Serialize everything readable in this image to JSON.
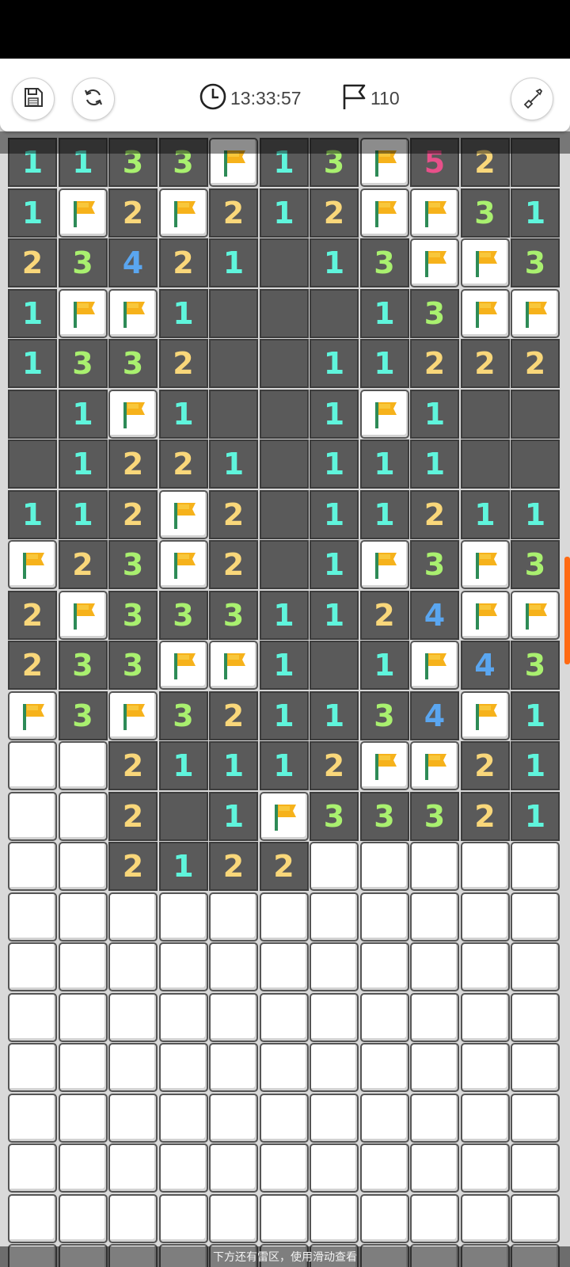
{
  "toolbar": {
    "timer": "13:33:57",
    "flags_remaining": "110",
    "buttons": [
      {
        "name": "save-button",
        "icon": "floppy-disk-icon"
      },
      {
        "name": "restart-button",
        "icon": "refresh-icon"
      },
      {
        "name": "tool-button",
        "icon": "shovel-icon"
      }
    ]
  },
  "board": {
    "columns": 11,
    "number_colors": {
      "1": "#5ff5dc",
      "2": "#f9d77a",
      "3": "#a9f06f",
      "4": "#5aa6f0",
      "5": "#e8508a"
    },
    "rows": [
      [
        "1",
        "1",
        "3",
        "3",
        "F",
        "1",
        "3",
        "F",
        "5",
        "2",
        "."
      ],
      [
        "1",
        "F",
        "2",
        "F",
        "2",
        "1",
        "2",
        "F",
        "F",
        "3",
        "1"
      ],
      [
        "2",
        "3",
        "4",
        "2",
        "1",
        ".",
        "1",
        "3",
        "F",
        "F",
        "3"
      ],
      [
        "1",
        "F",
        "F",
        "1",
        ".",
        ".",
        ".",
        "1",
        "3",
        "F",
        "F"
      ],
      [
        "1",
        "3",
        "3",
        "2",
        ".",
        ".",
        "1",
        "1",
        "2",
        "2",
        "2"
      ],
      [
        ".",
        "1",
        "F",
        "1",
        ".",
        ".",
        "1",
        "F",
        "1",
        ".",
        "."
      ],
      [
        ".",
        "1",
        "2",
        "2",
        "1",
        ".",
        "1",
        "1",
        "1",
        ".",
        "."
      ],
      [
        "1",
        "1",
        "2",
        "F",
        "2",
        ".",
        "1",
        "1",
        "2",
        "1",
        "1"
      ],
      [
        "F",
        "2",
        "3",
        "F",
        "2",
        ".",
        "1",
        "F",
        "3",
        "F",
        "3"
      ],
      [
        "2",
        "F",
        "3",
        "3",
        "3",
        "1",
        "1",
        "2",
        "4",
        "F",
        "F"
      ],
      [
        "2",
        "3",
        "3",
        "F",
        "F",
        "1",
        ".",
        "1",
        "F",
        "4",
        "3"
      ],
      [
        "F",
        "3",
        "F",
        "3",
        "2",
        "1",
        "1",
        "3",
        "4",
        "F",
        "1"
      ],
      [
        "#",
        "#",
        "2",
        "1",
        "1",
        "1",
        "2",
        "F",
        "F",
        "2",
        "1"
      ],
      [
        "#",
        "#",
        "2",
        ".",
        "1",
        "F",
        "3",
        "3",
        "3",
        "2",
        "1"
      ],
      [
        "#",
        "#",
        "2",
        "1",
        "2",
        "2",
        "#",
        "#",
        "#",
        "#",
        "#"
      ],
      [
        "#",
        "#",
        "#",
        "#",
        "#",
        "#",
        "#",
        "#",
        "#",
        "#",
        "#"
      ],
      [
        "#",
        "#",
        "#",
        "#",
        "#",
        "#",
        "#",
        "#",
        "#",
        "#",
        "#"
      ],
      [
        "#",
        "#",
        "#",
        "#",
        "#",
        "#",
        "#",
        "#",
        "#",
        "#",
        "#"
      ],
      [
        "#",
        "#",
        "#",
        "#",
        "#",
        "#",
        "#",
        "#",
        "#",
        "#",
        "#"
      ],
      [
        "#",
        "#",
        "#",
        "#",
        "#",
        "#",
        "#",
        "#",
        "#",
        "#",
        "#"
      ],
      [
        "#",
        "#",
        "#",
        "#",
        "#",
        "#",
        "#",
        "#",
        "#",
        "#",
        "#"
      ],
      [
        "#",
        "#",
        "#",
        "#",
        "#",
        "#",
        "#",
        "#",
        "#",
        "#",
        "#"
      ],
      [
        "#",
        "#",
        "#",
        "#",
        "#",
        "#",
        "#",
        "#",
        "#",
        "#",
        "#"
      ]
    ]
  },
  "hint": "下方还有雷区，使用滑动查看"
}
